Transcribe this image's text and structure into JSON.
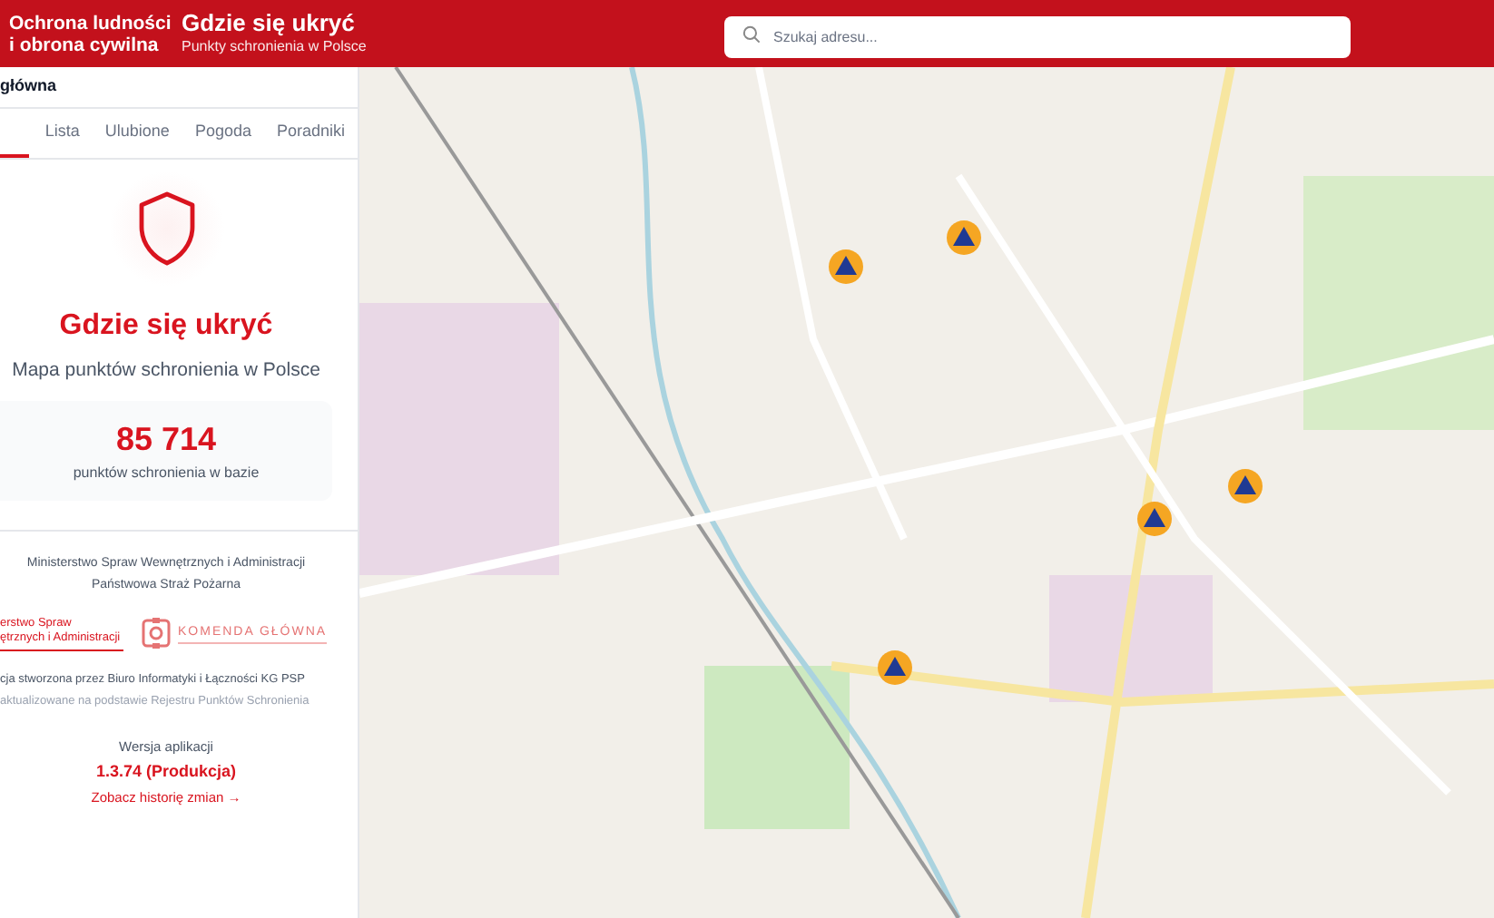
{
  "header": {
    "brand": [
      "Ochrona ludności",
      "i obrona cywilna"
    ],
    "title": "Gdzie się ukryć",
    "subtitle": "Punkty schronienia w Polsce",
    "search": {
      "placeholder": "Szukaj adresu..."
    }
  },
  "sidebar": {
    "heading": "główna",
    "tabs": [
      {
        "selected": true
      },
      {
        "label": "Lista",
        "selected": false
      },
      {
        "label": "Ulubione",
        "selected": false
      },
      {
        "label": "Pogoda",
        "selected": false
      },
      {
        "label": "Poradniki",
        "selected": false
      }
    ],
    "title": "Gdzie się ukryć",
    "subtitle": "Mapa punktów schronienia w Polsce",
    "stats": {
      "value": "85 714",
      "label": "punktów schronienia w bazie"
    },
    "institutions": [
      "Ministerstwo Spraw Wewnętrznych i Administracji",
      "Państwowa Straż Pożarna"
    ],
    "logos": {
      "left": [
        "erstwo Spraw",
        "ętrznych i Administracji"
      ],
      "right": "KOMENDA GŁÓWNA"
    },
    "credits": [
      "cja stworzona przez Biuro Informatyki i Łączności KG PSP",
      "aktualizowane na podstawie Rejestru Punktów Schronienia"
    ],
    "version": {
      "label": "Wersja aplikacji",
      "value": "1.3.74 (Produkcja)",
      "link": "Zobacz historię zmian →"
    }
  }
}
